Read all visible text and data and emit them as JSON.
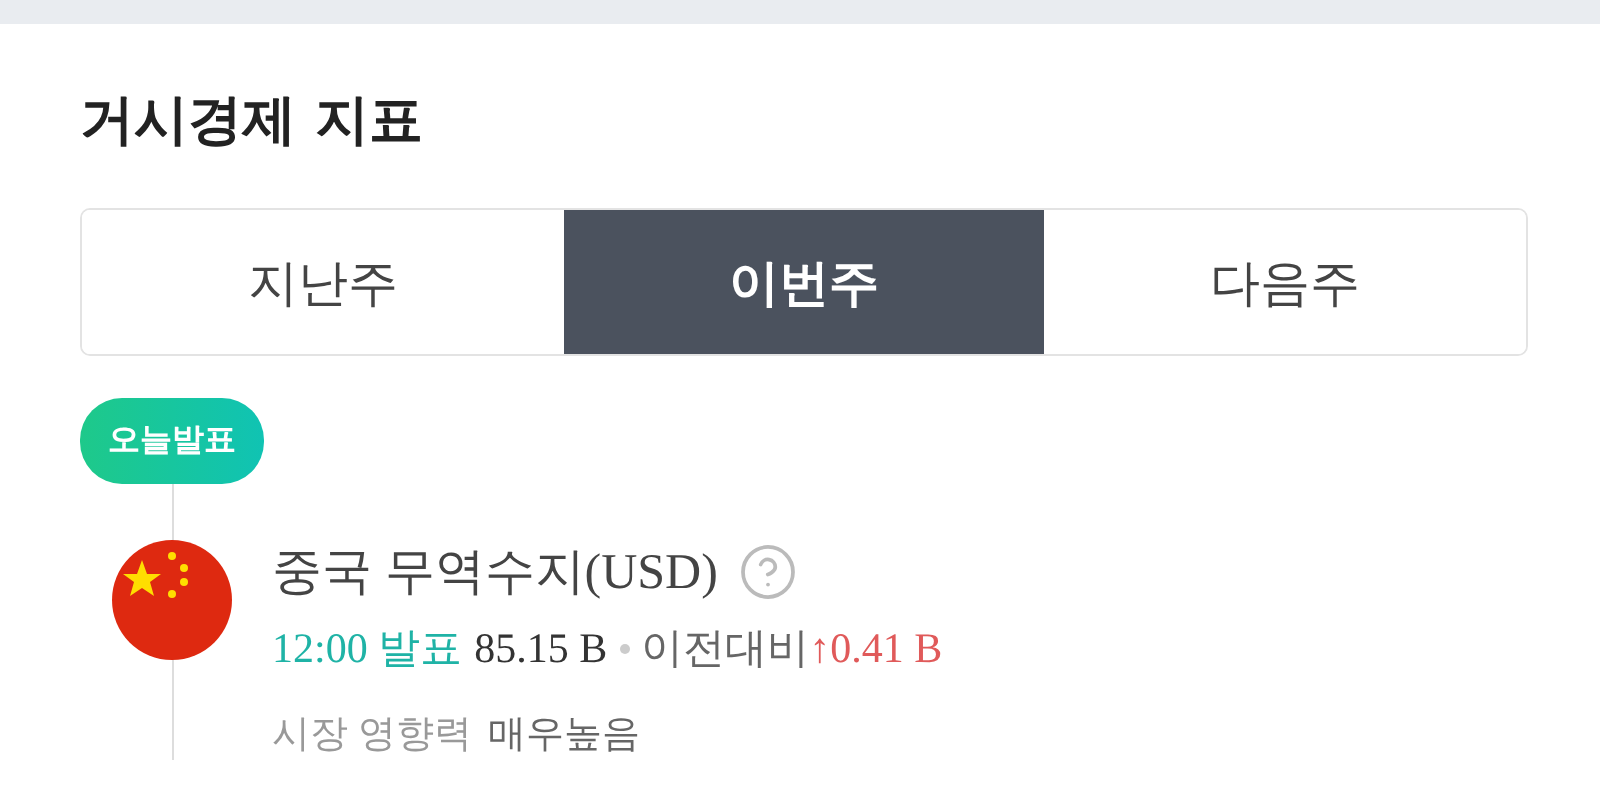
{
  "title": "거시경제 지표",
  "tabs": [
    {
      "label": "지난주",
      "selected": false
    },
    {
      "label": "이번주",
      "selected": true
    },
    {
      "label": "다음주",
      "selected": false
    }
  ],
  "badge": "오늘발표",
  "events": [
    {
      "name": "중국 무역수지(USD)",
      "time": "12:00 발표",
      "actual": "85.15 B",
      "compare_label": "이전대비",
      "change_arrow": "↑",
      "change": "0.41 B",
      "impact_label": "시장 영향력",
      "impact": "매우높음"
    }
  ]
}
